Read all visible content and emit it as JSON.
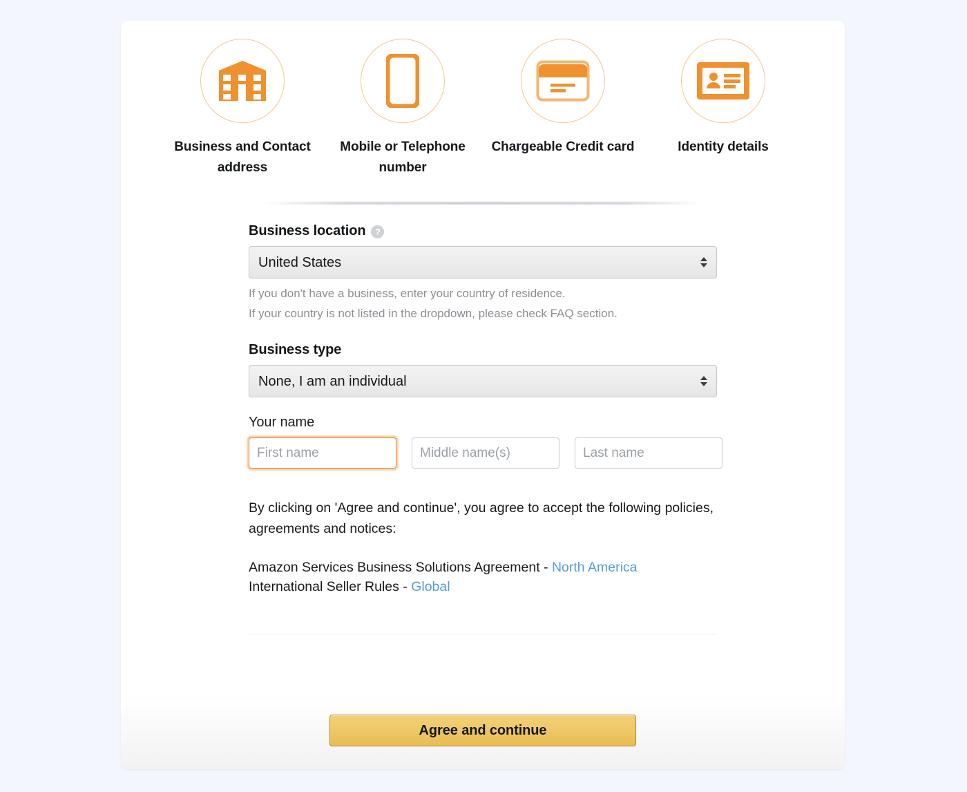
{
  "theme": {
    "page_background": "#f3f6fd",
    "card_background": "#ffffff",
    "accent_orange": "#ef912e",
    "circle_border": "#f5c58d",
    "link_blue": "#5a9bdc",
    "cta_gold": "#eec96a",
    "cta_border": "#b08c2e",
    "focus_orange": "#e6862b"
  },
  "steps": [
    {
      "icon": "office-building-icon",
      "label": "Business and Contact address"
    },
    {
      "icon": "mobile-phone-icon",
      "label": "Mobile or Telephone number"
    },
    {
      "icon": "credit-card-icon",
      "label": "Chargeable Credit card"
    },
    {
      "icon": "id-card-icon",
      "label": "Identity details"
    }
  ],
  "form": {
    "business_location": {
      "label": "Business location",
      "help_icon": "question-mark-icon",
      "help_glyph": "?",
      "selected": "United States",
      "options": [
        "United States"
      ],
      "hints": [
        "If you don't have a business, enter your country of residence.",
        "If your country is not listed in the dropdown, please check FAQ section."
      ]
    },
    "business_type": {
      "label": "Business type",
      "selected": "None, I am an individual",
      "options": [
        "None, I am an individual"
      ]
    },
    "your_name": {
      "label": "Your name",
      "first": {
        "placeholder": "First name",
        "value": "",
        "focused": true
      },
      "middle": {
        "placeholder": "Middle name(s)",
        "value": "",
        "focused": false
      },
      "last": {
        "placeholder": "Last name",
        "value": "",
        "focused": false
      }
    }
  },
  "policy": {
    "intro": "By clicking on 'Agree and continue', you agree to accept the following policies, agreements and notices:",
    "items": [
      {
        "text": "Amazon Services Business Solutions Agreement - ",
        "link": "North America"
      },
      {
        "text": "International Seller Rules - ",
        "link": "Global"
      }
    ]
  },
  "footer": {
    "cta_label": "Agree and continue"
  }
}
